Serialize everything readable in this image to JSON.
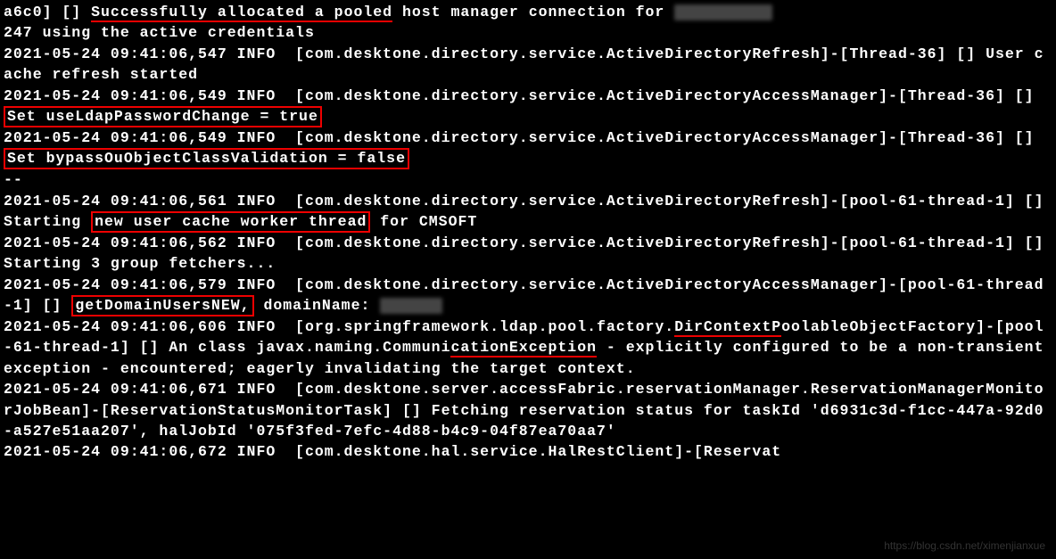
{
  "colors": {
    "highlight": "#e00",
    "bg": "#000",
    "fg": "#fff"
  },
  "log": {
    "l1a": "a6c0] [] ",
    "l1b": "Successfully allocated a pooled",
    "l1c": " host manager connection for ",
    "l2": "247 using the active credentials",
    "l3": "2021-05-24 09:41:06,547 INFO  [com.desktone.directory.service.ActiveDirectoryRefresh]-[Thread-36] [] User cache refresh started",
    "l4a": "2021-05-24 09:41:06,549 INFO  [com.desktone.directory.service.ActiveDirectoryAccessManager]-[Thread-36] [] ",
    "l4b": "Set useLdapPasswordChange = true",
    "l5a": "2021-05-24 09:41:06,549 INFO  [com.desktone.directory.service.ActiveDirectoryAccessManager]-[Thread-36] [] ",
    "l5b": "Set bypassOuObjectClassValidation = false",
    "dash": "--",
    "l6a": "2021-05-24 09:41:06,561 INFO  [com.desktone.directory.service.ActiveDirectoryRefresh]-[pool-61-thread-1] [] Starting ",
    "l6b": "new user cache worker thread",
    "l6c": " for CMSOFT",
    "l7": "2021-05-24 09:41:06,562 INFO  [com.desktone.directory.service.ActiveDirectoryRefresh]-[pool-61-thread-1] [] Starting 3 group fetchers...",
    "l8a": "2021-05-24 09:41:06,579 INFO  [com.desktone.directory.service.ActiveDirectoryAccessManager]-[pool-61-thread-1] [] ",
    "l8b": "getDomainUsersNEW,",
    "l8c": " domainName: ",
    "l9a": "2021-05-24 09:41:06,606 INFO  [org.springframework.ldap.pool.factory.",
    "l9b": "DirContextP",
    "l9c": "oolableObjectFactory]-[pool-61-thread-1] [] An class javax.naming.Communi",
    "l9d": "cationE",
    "l9e": "xception",
    "l9f": " - explicitly configured to be a non-transient exception - encountered; eagerly invalidating the target context.",
    "l10": "2021-05-24 09:41:06,671 INFO  [com.desktone.server.accessFabric.reservationManager.ReservationManagerMonitorJobBean]-[ReservationStatusMonitorTask] [] Fetching reservation status for taskId 'd6931c3d-f1cc-447a-92d0-a527e51aa207', halJobId '075f3fed-7efc-4d88-b4c9-04f87ea70aa7'",
    "l11": "2021-05-24 09:41:06,672 INFO  [com.desktone.hal.service.HalRestClient]-[Reservat"
  },
  "watermark": "https://blog.csdn.net/ximenjianxue"
}
